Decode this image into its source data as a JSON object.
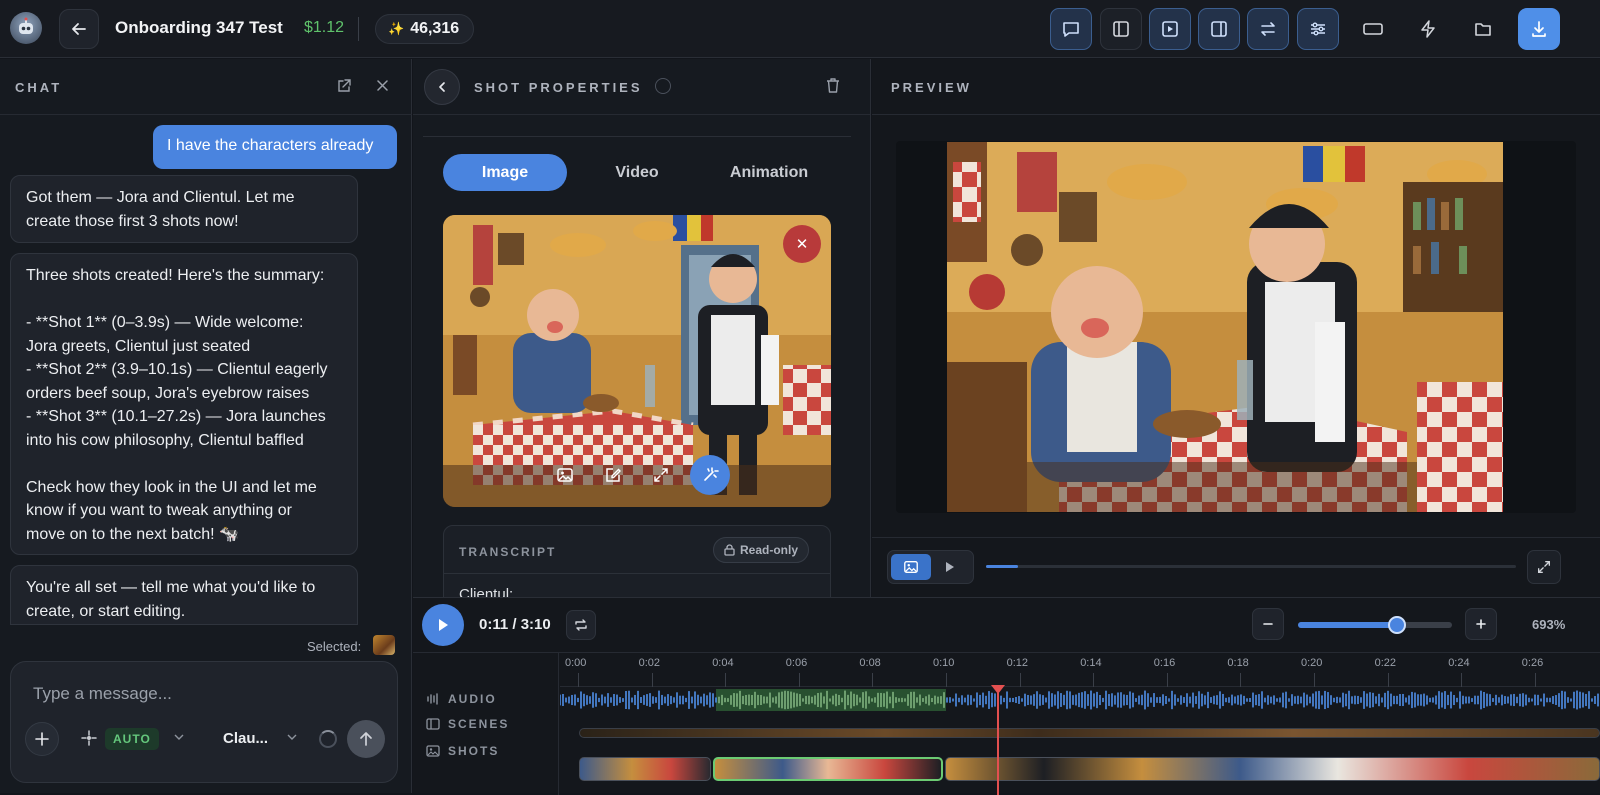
{
  "header": {
    "project_title": "Onboarding 347 Test",
    "cost": "$1.12",
    "credits": "46,316",
    "toolbar_icons": [
      "chat-icon",
      "panel-left-icon",
      "play-panel-icon",
      "panel-right-icon",
      "swap-icon",
      "sliders-icon",
      "aspect-ratio-icon",
      "lightning-icon",
      "folder-icon",
      "download-icon"
    ]
  },
  "chat": {
    "title": "CHAT",
    "messages": [
      {
        "role": "user",
        "text": "I have the characters already"
      },
      {
        "role": "assistant",
        "lines": [
          "Got them — Jora and Clientul. Let me",
          "create those first 3 shots now!"
        ]
      },
      {
        "role": "assistant",
        "lines": [
          "Three shots created! Here's the summary:",
          "",
          "- **Shot 1** (0–3.9s) — Wide welcome:",
          "Jora greets, Clientul just seated",
          "- **Shot 2** (3.9–10.1s) — Clientul eagerly",
          "orders beef soup, Jora's eyebrow raises",
          "- **Shot 3** (10.1–27.2s) — Jora launches",
          "into his cow philosophy, Clientul baffled",
          "",
          "Check how they look in the UI and let me",
          "know if you want to tweak anything or",
          "move on to the next batch! 🐄"
        ]
      },
      {
        "role": "assistant",
        "lines": [
          "You're all set — tell me what you'd like to",
          "create, or start editing."
        ]
      }
    ],
    "selected_label": "Selected:",
    "composer": {
      "placeholder": "Type a message...",
      "mode": "AUTO",
      "model": "Clau..."
    }
  },
  "shot_properties": {
    "title": "SHOT PROPERTIES",
    "tabs": [
      "Image",
      "Video",
      "Animation"
    ],
    "active_tab": "Image",
    "transcript": {
      "title": "TRANSCRIPT",
      "badge": "Read-only",
      "first_line": "Clientul:"
    }
  },
  "preview": {
    "title": "PREVIEW",
    "progress": 0.06
  },
  "timeline": {
    "timecode": "0:11 / 3:10",
    "zoom": "693%",
    "zoom_level": 0.64,
    "tracks": [
      "AUDIO",
      "SCENES",
      "SHOTS"
    ],
    "ticks": [
      "0:00",
      "0:02",
      "0:04",
      "0:06",
      "0:08",
      "0:10",
      "0:12",
      "0:14",
      "0:16",
      "0:18",
      "0:20",
      "0:22",
      "0:24",
      "0:26"
    ]
  },
  "colors": {
    "accent": "#4a84df",
    "cost_green": "#5fc26b",
    "playhead_red": "#e35050",
    "selection_green": "#6ccb73"
  }
}
